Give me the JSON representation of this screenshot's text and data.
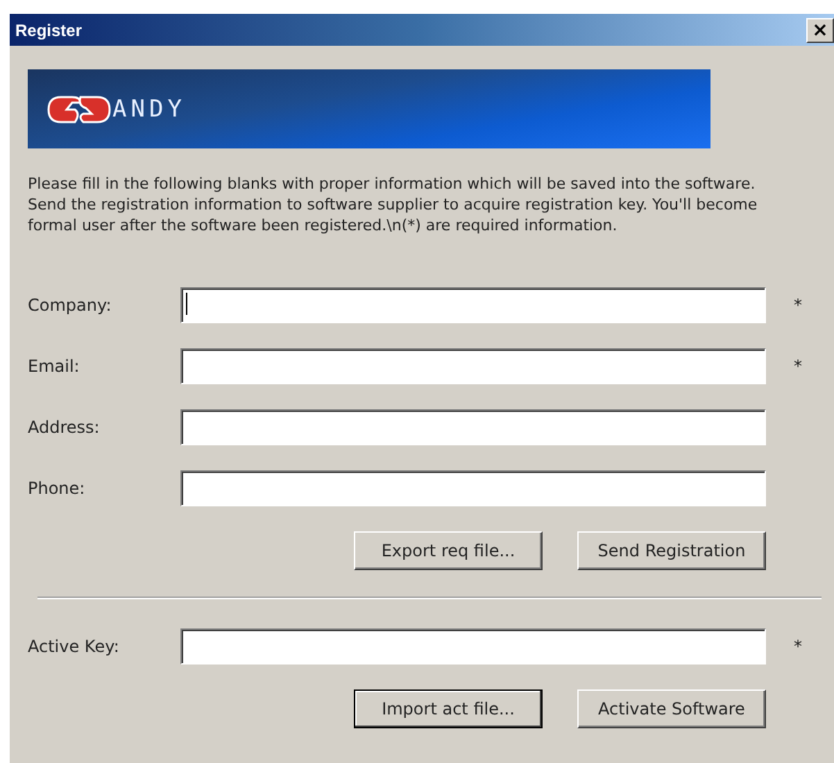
{
  "window": {
    "title": "Register",
    "close": "×"
  },
  "banner": {
    "logo_text": "ANDY"
  },
  "intro": "Please fill in the following blanks with proper information which will be saved into the software. Send the registration information to software supplier to acquire registration key. You'll become formal user after the software been registered.\\n(*) are required information.",
  "fields": [
    {
      "label": "Company:",
      "marker": "*",
      "focused": true
    },
    {
      "label": "Email:",
      "marker": "*",
      "focused": false
    },
    {
      "label": "Address:",
      "focused": false
    },
    {
      "label": "Phone:",
      "focused": false
    }
  ],
  "buttons": [
    {
      "label": "Export req file...",
      "default": false
    },
    {
      "label": "Send Registration",
      "default": false
    }
  ],
  "key_field": {
    "label": "Active Key:",
    "marker": "*",
    "focused": false
  },
  "key_buttons": [
    {
      "label": "Import act file...",
      "default": true
    },
    {
      "label": "Activate Software",
      "default": false
    }
  ]
}
